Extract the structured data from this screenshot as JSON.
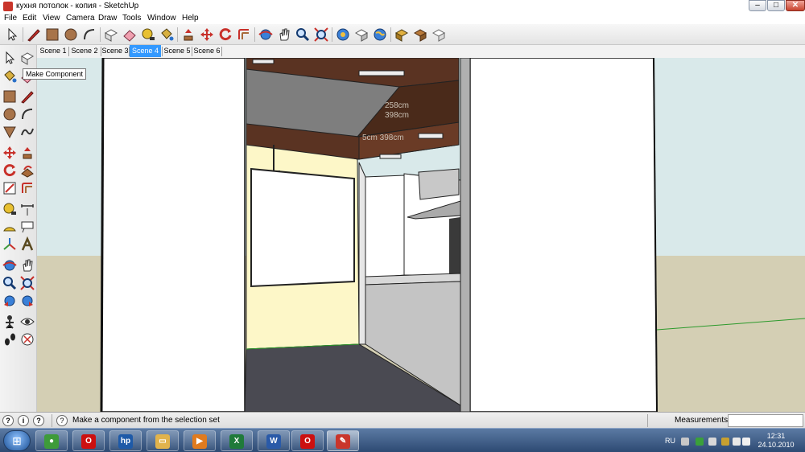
{
  "window": {
    "title": "кухня потолок - копия - SketchUp",
    "controls": {
      "minimize": "–",
      "maximize": "□",
      "close": "✕"
    }
  },
  "menu": [
    "File",
    "Edit",
    "View",
    "Camera",
    "Draw",
    "Tools",
    "Window",
    "Help"
  ],
  "main_toolbar": {
    "icons": [
      "select-icon",
      "pencil-icon",
      "rectangle-icon",
      "circle-icon",
      "arc-icon",
      "make-component-icon",
      "eraser-icon",
      "tape-measure-icon",
      "paint-bucket-icon",
      "push-pull-icon",
      "move-icon",
      "rotate-icon",
      "offset-icon",
      "orbit-icon",
      "pan-icon",
      "zoom-icon",
      "zoom-extents-icon",
      "get-models-icon",
      "share-model-icon",
      "google-earth-icon",
      "components-icon",
      "warehouse-icon",
      "extension-icon"
    ]
  },
  "left_toolbar": {
    "icons": [
      "select-icon",
      "make-component-icon",
      "paint-bucket-icon",
      "eraser-icon",
      "rectangle-icon",
      "line-icon",
      "circle-icon",
      "arc-icon",
      "polygon-icon",
      "freehand-icon",
      "move-icon",
      "push-pull-icon",
      "rotate-icon",
      "follow-me-icon",
      "scale-icon",
      "offset-icon",
      "tape-measure-icon",
      "dimension-icon",
      "protractor-icon",
      "text-icon",
      "axes-icon",
      "3d-text-icon",
      "orbit-icon",
      "pan-icon",
      "zoom-icon",
      "zoom-window-icon",
      "previous-view-icon",
      "next-view-icon",
      "position-camera-icon",
      "look-around-icon",
      "walk-icon",
      "section-plane-icon"
    ]
  },
  "tooltip": "Make Component",
  "scenes": {
    "tabs": [
      "Scene 1",
      "Scene 2",
      "Scene 3",
      "Scene 4",
      "Scene 5",
      "Scene 6"
    ],
    "active": "Scene 4"
  },
  "viewport": {
    "dimension_labels": [
      "258cm",
      "398cm",
      "5cm 398cm"
    ]
  },
  "status_bar": {
    "icons": [
      "geo-location-icon",
      "credits-icon",
      "help-icon"
    ],
    "message": "Make a component from the selection set",
    "measurements_label": "Measurements",
    "measurements_value": ""
  },
  "taskbar": {
    "start_glyph": "⊞",
    "apps": [
      {
        "name": "chrome",
        "glyph": "●",
        "color": "#3e9b3a"
      },
      {
        "name": "opera",
        "glyph": "O",
        "color": "#cc1010"
      },
      {
        "name": "hp",
        "glyph": "hp",
        "color": "#1e5aa8"
      },
      {
        "name": "explorer",
        "glyph": "▭",
        "color": "#e1b34c"
      },
      {
        "name": "media-player",
        "glyph": "▶",
        "color": "#e07b1f"
      },
      {
        "name": "excel",
        "glyph": "X",
        "color": "#1f7a3a"
      },
      {
        "name": "word",
        "glyph": "W",
        "color": "#2a5aa8"
      },
      {
        "name": "opera-2",
        "glyph": "O",
        "color": "#cc1010"
      },
      {
        "name": "sketchup",
        "glyph": "✎",
        "color": "#c9352b"
      }
    ],
    "tray": {
      "language": "RU",
      "time": "12:31",
      "date": "24.10.2010"
    }
  },
  "colors": {
    "accent_tab": "#3399ff",
    "beam": "#5a3322",
    "wall": "#fdf7c8",
    "floor": "#4a4a52",
    "ground": "#d4cfb4",
    "sky": "#d9e9ea"
  }
}
